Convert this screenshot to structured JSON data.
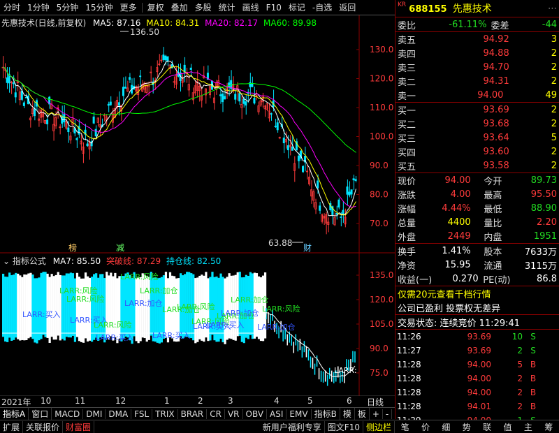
{
  "toolbar": {
    "left_items": [
      "分时",
      "1分钟",
      "5分钟",
      "15分钟",
      "更多",
      "复权",
      "叠加",
      "多股",
      "统计",
      "画线",
      "F10",
      "标记",
      "-自选",
      "返回"
    ]
  },
  "chart": {
    "title": "先惠技术(日线,前复权)",
    "ma5": "MA5: 87.16",
    "ma10": "MA10: 84.31",
    "ma20": "MA20: 82.17",
    "ma60": "MA60: 89.98",
    "high_label": "136.50",
    "low_label": "63.88",
    "marker_bang": "榜",
    "marker_jian": "减",
    "marker_cai": "财",
    "y_ticks": [
      "130.0",
      "120.0",
      "110.0",
      "100.0",
      "90.0",
      "80.0",
      "70.0"
    ],
    "colors": {
      "ma5": "#ffffff",
      "ma10": "#ffff00",
      "ma20": "#ff00ff",
      "ma60": "#00ff00",
      "up": "#ff3b3b",
      "down": "#00e5ff"
    }
  },
  "indicator": {
    "name": "指标公式",
    "ma7": "MA7: 85.50",
    "break_line": "突破线: 87.29",
    "hold_line": "持仓线: 82.50",
    "y_ticks": [
      "135.0",
      "120.0",
      "105.0",
      "90.0",
      "75.0"
    ],
    "annotations": [
      "LARR:风险",
      "LARR:风险",
      "LARR:买入",
      "LARR:买入",
      "LARR:加仓",
      "LARR:风险",
      "LARR:买入",
      "LARR:加仓",
      "LARR:风险",
      "LARR:加仓",
      "LARR:风险",
      "LARR:买入",
      "LARR:买入",
      "LARR:加仓",
      "LARR:加仓",
      "LARR:风险",
      "LARR:买入",
      "LARR:加仓",
      "LARR:风险",
      "LARR:加仓"
    ],
    "last_annotation": "LARR:"
  },
  "xaxis": {
    "labels": [
      "2021年",
      "10",
      "11",
      "12",
      "1",
      "2",
      "3",
      "4",
      "5",
      "6"
    ],
    "period": "日线"
  },
  "bottom_tabs": [
    "指标A",
    "窗口",
    "MACD",
    "DMI",
    "DMA",
    "FSL",
    "TRIX",
    "BRAR",
    "CR",
    "VR",
    "OBV",
    "ASI",
    "EMV",
    "指标B",
    "模",
    "板",
    "+",
    "-"
  ],
  "status_bar": [
    "扩展",
    "关联报价",
    "财富圈",
    "新用户福利专享",
    "图文F10",
    "侧边栏"
  ],
  "right_tabs": [
    "笔",
    "价",
    "细",
    "势",
    "联",
    "值",
    "主",
    "筹"
  ],
  "stock": {
    "code": "688155",
    "name": "先惠技术",
    "prefix": "KR",
    "webi_label": "委比",
    "webi_value": "-61.11%",
    "weicha_label": "委差",
    "weicha_value": "-44",
    "sell": [
      {
        "label": "卖五",
        "price": "94.92",
        "vol": "3"
      },
      {
        "label": "卖四",
        "price": "94.88",
        "vol": "2"
      },
      {
        "label": "卖三",
        "price": "94.70",
        "vol": "2"
      },
      {
        "label": "卖二",
        "price": "94.31",
        "vol": "2"
      },
      {
        "label": "卖一",
        "price": "94.00",
        "vol": "49"
      }
    ],
    "buy": [
      {
        "label": "买一",
        "price": "93.69",
        "vol": "2"
      },
      {
        "label": "买二",
        "price": "93.68",
        "vol": "2"
      },
      {
        "label": "买三",
        "price": "93.64",
        "vol": "5"
      },
      {
        "label": "买四",
        "price": "93.60",
        "vol": "2"
      },
      {
        "label": "买五",
        "price": "93.58",
        "vol": "2"
      }
    ],
    "stats": [
      {
        "l1": "现价",
        "v1": "94.00",
        "c1": "red",
        "l2": "今开",
        "v2": "89.73",
        "c2": "grn"
      },
      {
        "l1": "涨跌",
        "v1": "4.00",
        "c1": "red",
        "l2": "最高",
        "v2": "95.50",
        "c2": "red"
      },
      {
        "l1": "涨幅",
        "v1": "4.44%",
        "c1": "red",
        "l2": "最低",
        "v2": "88.90",
        "c2": "grn"
      },
      {
        "l1": "总量",
        "v1": "4400",
        "c1": "yel",
        "l2": "量比",
        "v2": "2.20",
        "c2": "red"
      },
      {
        "l1": "外盘",
        "v1": "2449",
        "c1": "red",
        "l2": "内盘",
        "v2": "1951",
        "c2": "grn"
      }
    ],
    "stats2": [
      {
        "l1": "换手",
        "v1": "1.41%",
        "l2": "股本",
        "v2": "7633万"
      },
      {
        "l1": "净资",
        "v1": "15.95",
        "l2": "流通",
        "v2": "3115万"
      },
      {
        "l1": "收益(一)",
        "v1": "0.270",
        "l2": "PE(动)",
        "v2": "86.8"
      }
    ],
    "promo": "仅需20元查看千档行情",
    "info": "公司已盈利 投票权无差异",
    "trade_status": "交易状态: 连续竞价 11:29:41",
    "ticks": [
      {
        "time": "11:26",
        "price": "93.69",
        "vol": "10",
        "side": "S"
      },
      {
        "time": "11:27",
        "price": "93.69",
        "vol": "2",
        "side": "S"
      },
      {
        "time": "11:28",
        "price": "94.00",
        "vol": "5",
        "side": "B"
      },
      {
        "time": "11:28",
        "price": "94.00",
        "vol": "2",
        "side": "B"
      },
      {
        "time": "11:28",
        "price": "94.00",
        "vol": "2",
        "side": "B"
      },
      {
        "time": "11:28",
        "price": "94.01",
        "vol": "2",
        "side": "B"
      },
      {
        "time": "11:29",
        "price": "94.00",
        "vol": "1",
        "side": "S"
      }
    ]
  }
}
